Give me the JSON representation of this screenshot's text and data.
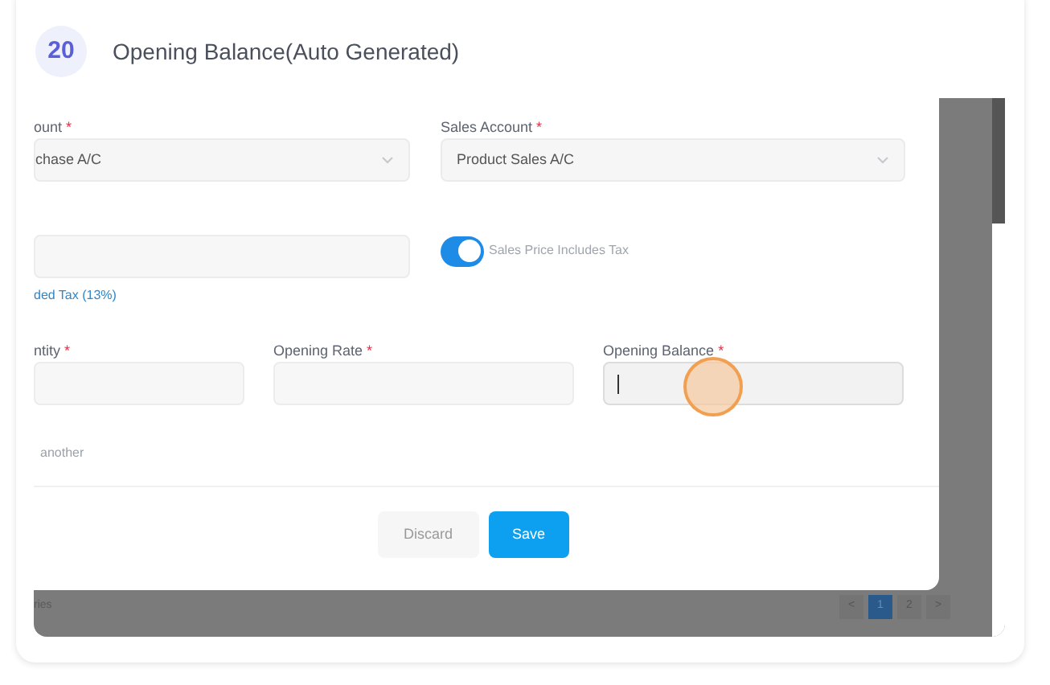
{
  "step": {
    "number": "20",
    "title": "Opening Balance(Auto Generated)"
  },
  "form": {
    "row_1": [
      {
        "kind": "select",
        "label": "ount",
        "required_mark": "*",
        "value": "chase A/C"
      },
      {
        "kind": "select",
        "label": "Sales Account",
        "required_mark": "*",
        "value": "Product Sales A/C"
      }
    ],
    "row_2": [
      {
        "kind": "input",
        "link": "ded Tax (13%)",
        "focused": false
      },
      {
        "kind": "toggle",
        "label": "Sales Price Includes Tax",
        "on": true
      }
    ],
    "row_3": [
      {
        "kind": "input",
        "label": "ntity",
        "required_mark": "*",
        "focused": false
      },
      {
        "kind": "input",
        "label": "Opening Rate",
        "required_mark": "*",
        "focused": false
      },
      {
        "kind": "input",
        "label": "Opening Balance",
        "required_mark": "*",
        "focused": true
      }
    ],
    "option_text": "another",
    "buttons": [
      {
        "kind": "secondary",
        "label": "Discard"
      },
      {
        "kind": "primary",
        "label": "Save"
      }
    ]
  },
  "background": {
    "text": "ries",
    "pages": [
      {
        "label": "<",
        "selected": false
      },
      {
        "label": "1",
        "selected": true
      },
      {
        "label": "2",
        "selected": false
      },
      {
        "label": ">",
        "selected": false
      }
    ]
  }
}
